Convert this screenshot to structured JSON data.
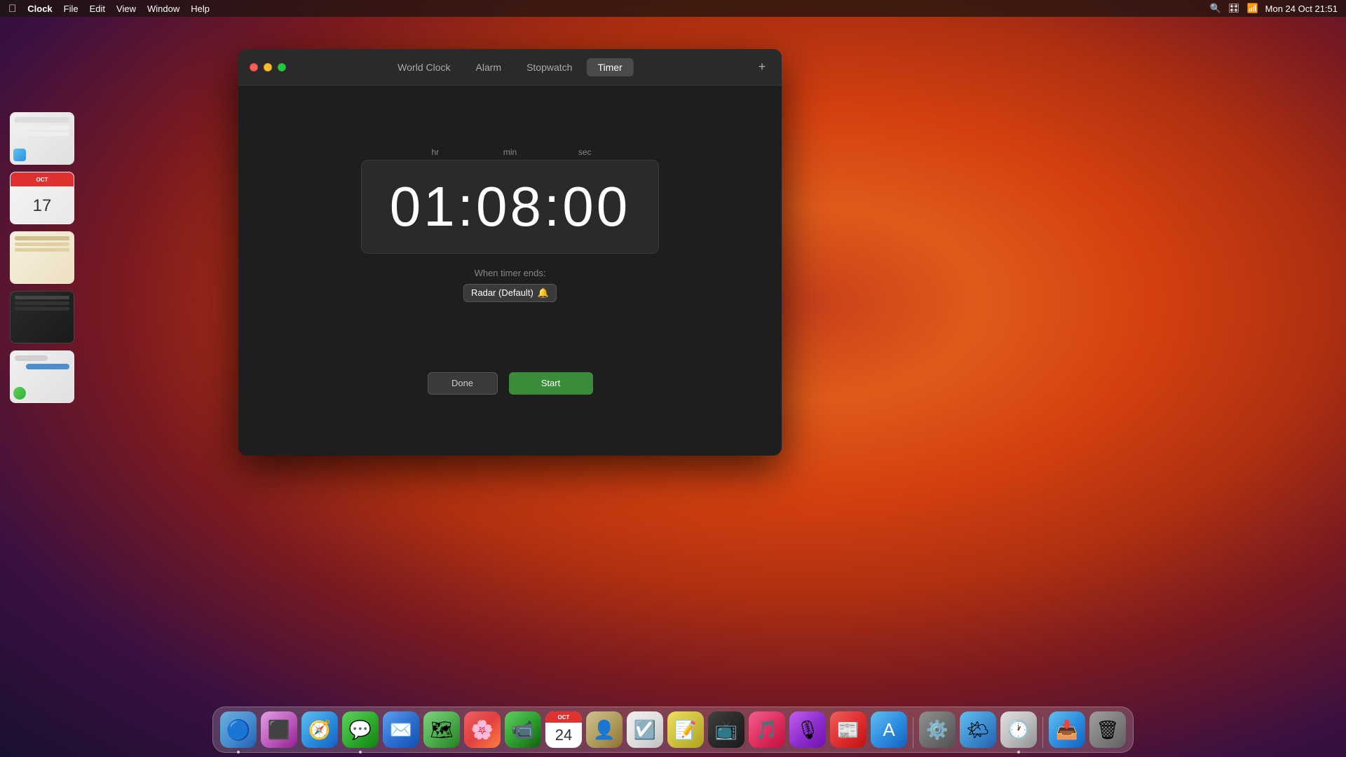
{
  "menubar": {
    "apple": "🍎",
    "app_name": "Clock",
    "menu_items": [
      "File",
      "Edit",
      "View",
      "Window",
      "Help"
    ],
    "right_items": [
      "🔍",
      "🗓",
      "Mon 24 Oct  21:51"
    ]
  },
  "clock_window": {
    "tabs": [
      {
        "label": "World Clock",
        "active": false
      },
      {
        "label": "Alarm",
        "active": false
      },
      {
        "label": "Stopwatch",
        "active": false
      },
      {
        "label": "Timer",
        "active": true
      }
    ],
    "add_button": "+",
    "timer": {
      "hr_label": "hr",
      "min_label": "min",
      "sec_label": "sec",
      "display": "01:08:00",
      "when_ends_label": "When timer ends:",
      "sound_name": "Radar (Default)",
      "sound_emoji": "🔔"
    },
    "buttons": {
      "done": "Done",
      "start": "Start"
    }
  },
  "dock": {
    "items": [
      {
        "name": "finder",
        "icon": "🔵",
        "label": "Finder",
        "icon_class": "icon-finder"
      },
      {
        "name": "launchpad",
        "icon": "🚀",
        "label": "Launchpad",
        "icon_class": "icon-launchpad"
      },
      {
        "name": "safari",
        "icon": "🧭",
        "label": "Safari",
        "icon_class": "icon-safari"
      },
      {
        "name": "messages",
        "icon": "💬",
        "label": "Messages",
        "icon_class": "icon-messages"
      },
      {
        "name": "mail",
        "icon": "✉️",
        "label": "Mail",
        "icon_class": "icon-mail"
      },
      {
        "name": "maps",
        "icon": "🗺",
        "label": "Maps",
        "icon_class": "icon-maps"
      },
      {
        "name": "photos",
        "icon": "🌸",
        "label": "Photos",
        "icon_class": "icon-photos"
      },
      {
        "name": "facetime",
        "icon": "📷",
        "label": "FaceTime",
        "icon_class": "icon-facetime"
      },
      {
        "name": "calendar",
        "icon": "📅",
        "label": "Calendar",
        "icon_class": "icon-calendar",
        "date": "24"
      },
      {
        "name": "contacts",
        "icon": "👤",
        "label": "Contacts",
        "icon_class": "icon-contacts"
      },
      {
        "name": "reminders",
        "icon": "☑️",
        "label": "Reminders",
        "icon_class": "icon-reminders"
      },
      {
        "name": "notes",
        "icon": "📝",
        "label": "Notes",
        "icon_class": "icon-notes"
      },
      {
        "name": "appletv",
        "icon": "📺",
        "label": "Apple TV",
        "icon_class": "icon-appletv"
      },
      {
        "name": "music",
        "icon": "🎵",
        "label": "Music",
        "icon_class": "icon-music"
      },
      {
        "name": "podcasts",
        "icon": "🎙",
        "label": "Podcasts",
        "icon_class": "icon-podcasts"
      },
      {
        "name": "news",
        "icon": "📰",
        "label": "News",
        "icon_class": "icon-news"
      },
      {
        "name": "appstore",
        "icon": "🅰",
        "label": "App Store",
        "icon_class": "icon-appstore"
      },
      {
        "name": "syspreferences",
        "icon": "⚙️",
        "label": "System Preferences",
        "icon_class": "icon-syspreferences"
      },
      {
        "name": "weather",
        "icon": "🌤",
        "label": "Weather",
        "icon_class": "icon-weather"
      },
      {
        "name": "clock",
        "icon": "🕐",
        "label": "Clock",
        "icon_class": "icon-clock"
      },
      {
        "name": "airdrop",
        "icon": "📥",
        "label": "AirDrop",
        "icon_class": "icon-airdrop"
      },
      {
        "name": "trash",
        "icon": "🗑",
        "label": "Trash",
        "icon_class": "icon-trash"
      }
    ]
  }
}
